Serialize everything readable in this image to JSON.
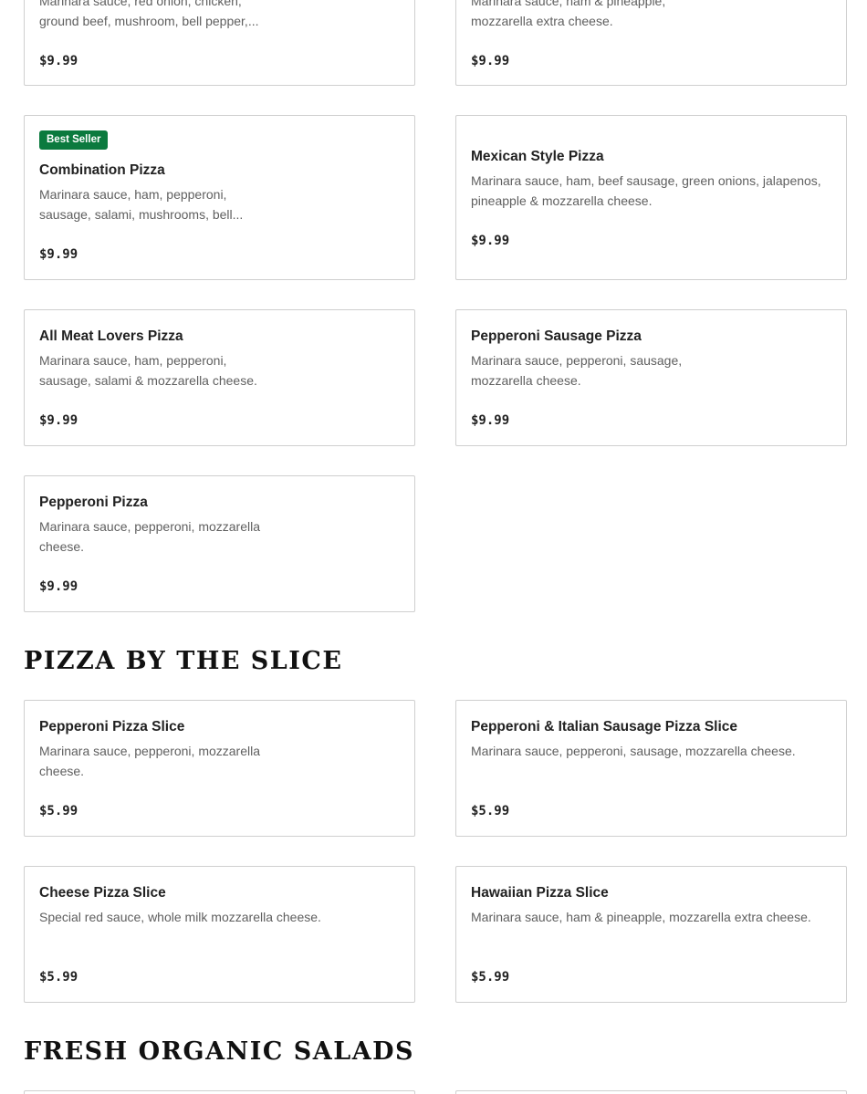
{
  "menu": {
    "top_left": {
      "desc_line1": "Marinara sauce, red onion, chicken,",
      "desc_line2": "ground beef, mushroom, bell pepper,...",
      "price": "$9.99"
    },
    "top_right": {
      "desc_line1": "Marinara sauce, ham & pineapple,",
      "desc_line2": "mozzarella extra cheese.",
      "price": "$9.99"
    },
    "combination": {
      "badge": "Best Seller",
      "name": "Combination Pizza",
      "desc_line1": "Marinara sauce, ham, pepperoni,",
      "desc_line2": "sausage, salami, mushrooms, bell...",
      "price": "$9.99"
    },
    "mexican": {
      "name": "Mexican Style Pizza",
      "desc_line1": "Marinara sauce, ham, beef sausage, green onions, jalapenos,",
      "desc_line2": "pineapple & mozzarella cheese.",
      "price": "$9.99"
    },
    "all_meat": {
      "name": "All Meat Lovers Pizza",
      "desc_line1": "Marinara sauce, ham, pepperoni,",
      "desc_line2": "sausage, salami & mozzarella cheese.",
      "price": "$9.99"
    },
    "pepperoni_sausage": {
      "name": "Pepperoni Sausage Pizza",
      "desc_line1": "Marinara sauce, pepperoni, sausage,",
      "desc_line2": "mozzarella cheese.",
      "price": "$9.99"
    },
    "pepperoni": {
      "name": "Pepperoni Pizza",
      "desc_line1": "Marinara sauce, pepperoni, mozzarella",
      "desc_line2": "cheese.",
      "price": "$9.99"
    }
  },
  "slice_section": {
    "title": "PIZZA BY THE SLICE",
    "pepperoni_slice": {
      "name": "Pepperoni Pizza Slice",
      "desc_line1": "Marinara sauce, pepperoni, mozzarella",
      "desc_line2": "cheese.",
      "price": "$5.99"
    },
    "pep_italian_slice": {
      "name": "Pepperoni & Italian Sausage Pizza Slice",
      "desc_line1": "Marinara sauce, pepperoni, sausage, mozzarella cheese.",
      "price": "$5.99"
    },
    "cheese_slice": {
      "name": "Cheese Pizza Slice",
      "desc_line1": "Special red sauce, whole milk mozzarella cheese.",
      "price": "$5.99"
    },
    "hawaiian_slice": {
      "name": "Hawaiian Pizza Slice",
      "desc_line1": "Marinara sauce, ham & pineapple, mozzarella extra cheese.",
      "price": "$5.99"
    }
  },
  "salads_section": {
    "title": "FRESH ORGANIC SALADS"
  },
  "colors": {
    "badge_bg": "#0b7a3e",
    "border": "#cfcfcf",
    "desc_text": "#5f5f5f"
  }
}
